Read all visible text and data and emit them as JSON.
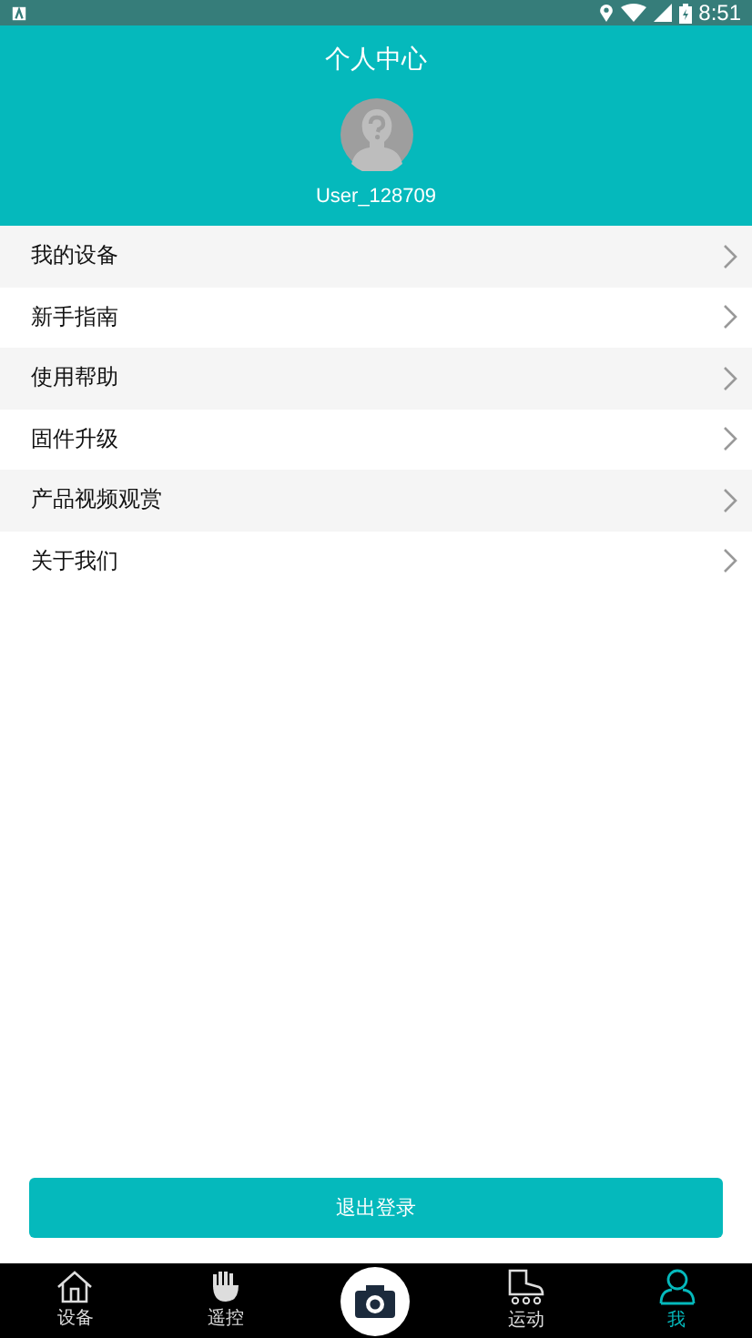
{
  "status_bar": {
    "time": "8:51"
  },
  "header": {
    "title": "个人中心",
    "username": "User_128709"
  },
  "menu": [
    {
      "label": "我的设备"
    },
    {
      "label": "新手指南"
    },
    {
      "label": "使用帮助"
    },
    {
      "label": "固件升级"
    },
    {
      "label": "产品视频观赏"
    },
    {
      "label": "关于我们"
    }
  ],
  "logout_button": "退出登录",
  "nav": [
    {
      "kind": "home",
      "label": "设备",
      "selected": false
    },
    {
      "kind": "hand",
      "label": "遥控",
      "selected": false
    },
    {
      "kind": "camera",
      "selected": false
    },
    {
      "kind": "skate",
      "label": "运动",
      "selected": false
    },
    {
      "kind": "person",
      "label": "我",
      "selected": true
    }
  ]
}
